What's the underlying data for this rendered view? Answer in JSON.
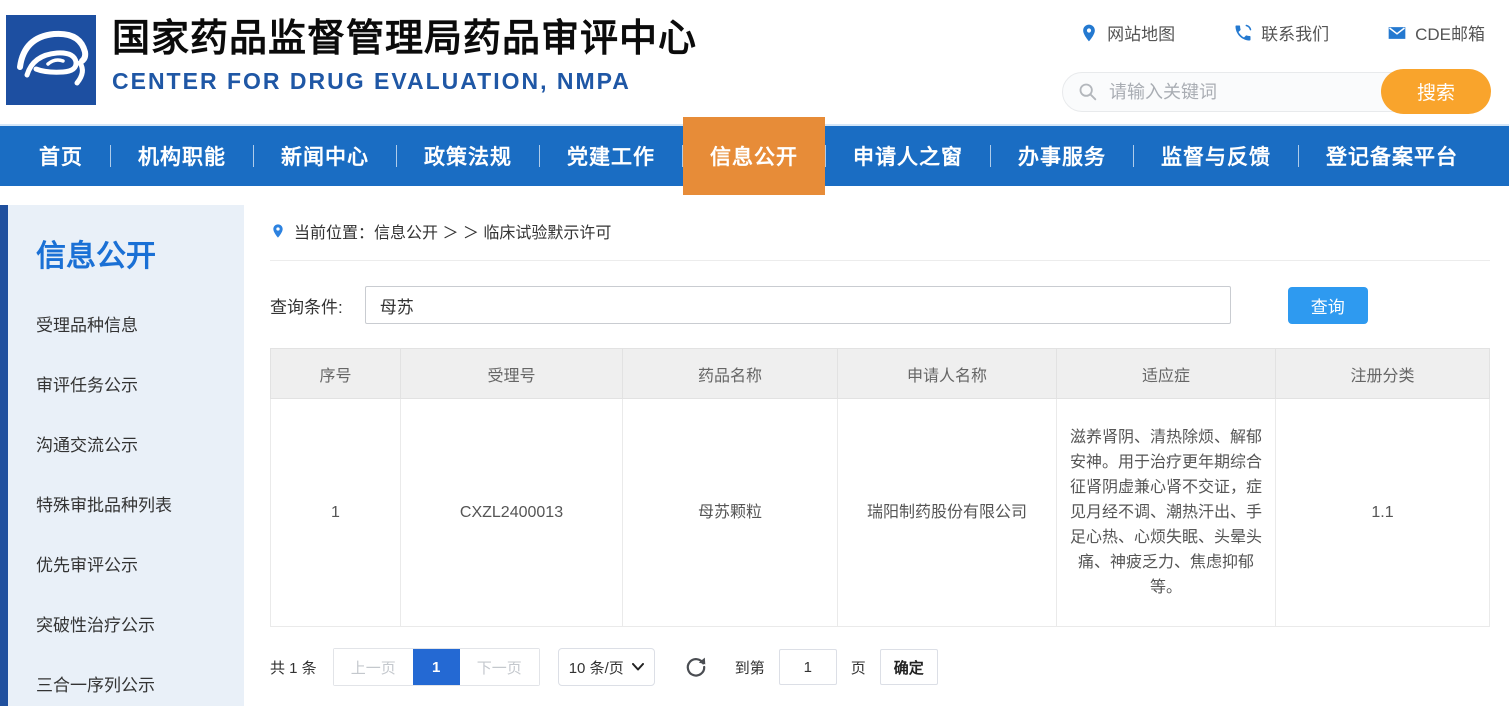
{
  "header": {
    "title": "国家药品监督管理局药品审评中心",
    "subtitle": "CENTER FOR DRUG EVALUATION, NMPA",
    "quick_links": [
      {
        "label": "网站地图",
        "icon": "location-pin-icon"
      },
      {
        "label": "联系我们",
        "icon": "phone-icon"
      },
      {
        "label": "CDE邮箱",
        "icon": "mail-icon"
      }
    ],
    "search": {
      "placeholder": "请输入关键词",
      "button_label": "搜索"
    }
  },
  "nav": {
    "items": [
      {
        "label": "首页",
        "active": false
      },
      {
        "label": "机构职能",
        "active": false
      },
      {
        "label": "新闻中心",
        "active": false
      },
      {
        "label": "政策法规",
        "active": false
      },
      {
        "label": "党建工作",
        "active": false
      },
      {
        "label": "信息公开",
        "active": true
      },
      {
        "label": "申请人之窗",
        "active": false
      },
      {
        "label": "办事服务",
        "active": false
      },
      {
        "label": "监督与反馈",
        "active": false
      },
      {
        "label": "登记备案平台",
        "active": false
      }
    ]
  },
  "sidebar": {
    "title": "信息公开",
    "items": [
      "受理品种信息",
      "审评任务公示",
      "沟通交流公示",
      "特殊审批品种列表",
      "优先审评公示",
      "突破性治疗公示",
      "三合一序列公示"
    ]
  },
  "breadcrumb": {
    "text": "当前位置：信息公开 ＞ ＞ 临床试验默示许可"
  },
  "query": {
    "label": "查询条件:",
    "value": "母苏",
    "button_label": "查询"
  },
  "table": {
    "headers": [
      "序号",
      "受理号",
      "药品名称",
      "申请人名称",
      "适应症",
      "注册分类"
    ],
    "rows": [
      [
        "1",
        "CXZL2400013",
        "母苏颗粒",
        "瑞阳制药股份有限公司",
        "滋养肾阴、清热除烦、解郁安神。用于治疗更年期综合征肾阴虚兼心肾不交证，症见月经不调、潮热汗出、手足心热、心烦失眠、头晕头痛、神疲乏力、焦虑抑郁等。",
        "1.1"
      ]
    ]
  },
  "pagination": {
    "total_text": "共 1 条",
    "prev_label": "上一页",
    "current_page": "1",
    "next_label": "下一页",
    "page_size_label": "10 条/页",
    "goto_label": "到第",
    "goto_value": "1",
    "goto_unit": "页",
    "confirm_label": "确定"
  },
  "colors": {
    "nav_blue": "#1a6dc3",
    "active_tab_orange": "#e78c38",
    "search_button_orange": "#f9a42c",
    "logo_blue": "#1d4fa1",
    "link_icon_blue": "#2479d0",
    "query_button_blue": "#2e9af0",
    "pager_active_blue": "#2469d3",
    "sidebar_bg": "#e9f0f8",
    "sidebar_title_blue": "#1a70d5"
  }
}
